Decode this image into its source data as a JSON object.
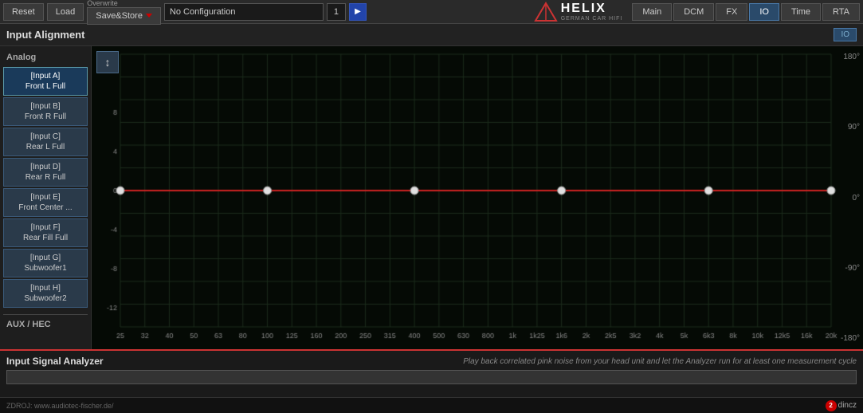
{
  "topbar": {
    "reset_label": "Reset",
    "load_label": "Load",
    "overwrite_label": "Overwrite",
    "save_store_label": "Save&Store",
    "config_value": "No Configuration",
    "config_num": "1",
    "nav_items": [
      "Main",
      "DCM",
      "FX",
      "IO",
      "Time",
      "RTA"
    ],
    "active_nav": "IO"
  },
  "section": {
    "title": "Input Alignment",
    "io_label": "IO"
  },
  "sidebar": {
    "analog_label": "Analog",
    "inputs": [
      {
        "id": "A",
        "label": "[Input A]\nFront L Full"
      },
      {
        "id": "B",
        "label": "[Input B]\nFront R Full"
      },
      {
        "id": "C",
        "label": "[Input C]\nRear L Full"
      },
      {
        "id": "D",
        "label": "[Input D]\nRear R Full"
      },
      {
        "id": "E",
        "label": "[Input E]\nFront Center ..."
      },
      {
        "id": "F",
        "label": "[Input F]\nRear Fill Full"
      },
      {
        "id": "G",
        "label": "[Input G]\nSubwoofer1"
      },
      {
        "id": "H",
        "label": "[Input H]\nSubwoofer2"
      }
    ],
    "aux_label": "AUX / HEC"
  },
  "chart": {
    "x_labels": [
      "25",
      "32",
      "40",
      "50",
      "63",
      "80",
      "100",
      "125",
      "160",
      "200",
      "250",
      "315",
      "400",
      "500",
      "630",
      "800",
      "1k",
      "1k25",
      "1k6",
      "2k",
      "2k5",
      "3k2",
      "4k",
      "5k",
      "6k3",
      "8k",
      "10k",
      "12k5",
      "16k",
      "20k"
    ],
    "y_labels_right": [
      "180°",
      "90°",
      "0°",
      "-90°",
      "-180°"
    ],
    "scroll_btn": "↕"
  },
  "analyzer": {
    "title": "Input Signal Analyzer",
    "description": "Play back correlated pink noise from your head unit and let the Analyzer run for at least one measurement cycle"
  },
  "footer": {
    "url": "ZDROJ: www.audiotec-fischer.de/",
    "badge_num": "2",
    "badge_text": "dincz"
  },
  "colors": {
    "accent_red": "#cc3333",
    "grid": "#1e2e1e",
    "line_red": "#dd2222",
    "dot_color": "#ffffff",
    "bg_dark": "#0a0a0a",
    "nav_active": "#2a4a6a"
  }
}
